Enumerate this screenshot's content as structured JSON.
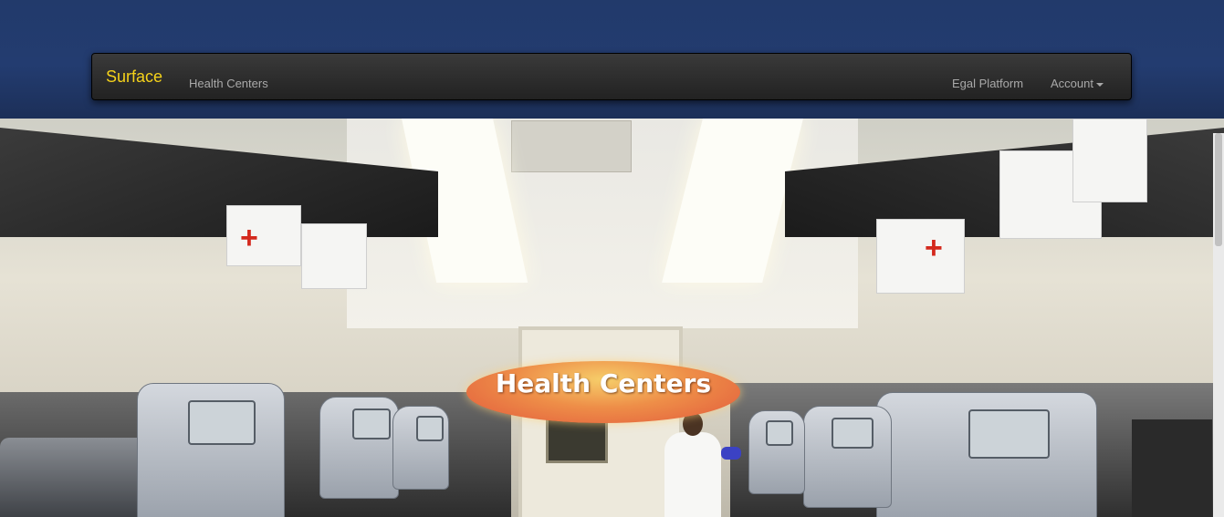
{
  "navbar": {
    "brand": "Surface",
    "links": [
      {
        "label": "Health Centers"
      },
      {
        "label": "Egal Platform"
      },
      {
        "label": "Account"
      }
    ]
  },
  "hero": {
    "title": "Health Centers"
  },
  "colors": {
    "header_bg": "#223a6b",
    "navbar_bg": "#2a2a2a",
    "brand": "#f5d21a",
    "nav_link": "#a9a9a9",
    "title_oval": "#ee8e48"
  }
}
